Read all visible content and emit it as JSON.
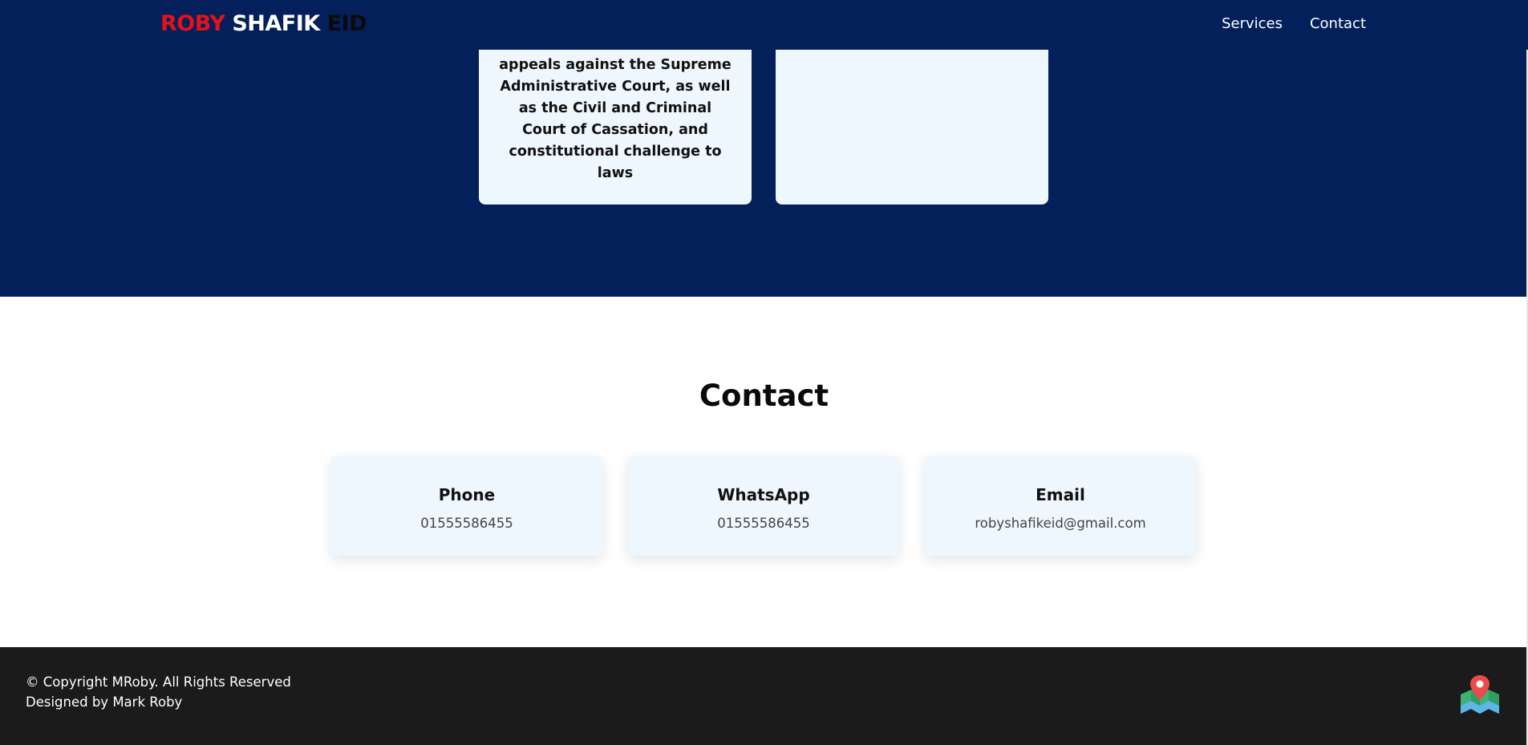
{
  "header": {
    "logo": {
      "part1": "ROBY",
      "part2": "SHAFIK",
      "part3": "EID"
    },
    "nav": [
      {
        "label": "Services"
      },
      {
        "label": "Contact"
      }
    ]
  },
  "services": {
    "cards": [
      {
        "text": "appeals against the Supreme Administrative Court, as well as the Civil and Criminal Court of Cassation, and constitutional challenge to laws"
      },
      {
        "text": ""
      }
    ]
  },
  "contact": {
    "title": "Contact",
    "cards": [
      {
        "title": "Phone",
        "value": "01555586455"
      },
      {
        "title": "WhatsApp",
        "value": "01555586455"
      },
      {
        "title": "Email",
        "value": "robyshafikeid@gmail.com"
      }
    ]
  },
  "footer": {
    "copyright": "© Copyright MRoby. All Rights Reserved",
    "designed_by": "Designed by Mark Roby",
    "map_icon": "map-icon"
  },
  "colors": {
    "navy": "#04205a",
    "brand_red": "#e0131b",
    "card_bg": "#eef6fe",
    "footer_bg": "#1b1b1b"
  }
}
